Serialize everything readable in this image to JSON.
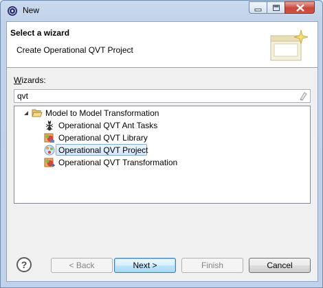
{
  "window": {
    "title": "New"
  },
  "banner": {
    "title": "Select a wizard",
    "description": "Create Operational QVT Project"
  },
  "wizards": {
    "label_mnemonic": "W",
    "label_rest": "izards:",
    "filter_value": "qvt"
  },
  "tree": {
    "category": {
      "label": "Model to Model Transformation",
      "icon": "folder-open-icon",
      "expanded": true
    },
    "items": [
      {
        "label": "Operational QVT Ant Tasks",
        "icon": "ant-icon",
        "selected": false
      },
      {
        "label": "Operational QVT Library",
        "icon": "qvt-library-icon",
        "selected": false
      },
      {
        "label": "Operational QVT Project",
        "icon": "qvt-project-icon",
        "selected": true
      },
      {
        "label": "Operational QVT Transformation",
        "icon": "qvt-transformation-icon",
        "selected": false
      }
    ]
  },
  "buttons": {
    "help": "?",
    "back": "< Back",
    "next": "Next >",
    "finish": "Finish",
    "cancel": "Cancel"
  },
  "colors": {
    "selection": "#d4e7fa",
    "title_bar": "#c9daee",
    "close_button": "#c9463d"
  }
}
